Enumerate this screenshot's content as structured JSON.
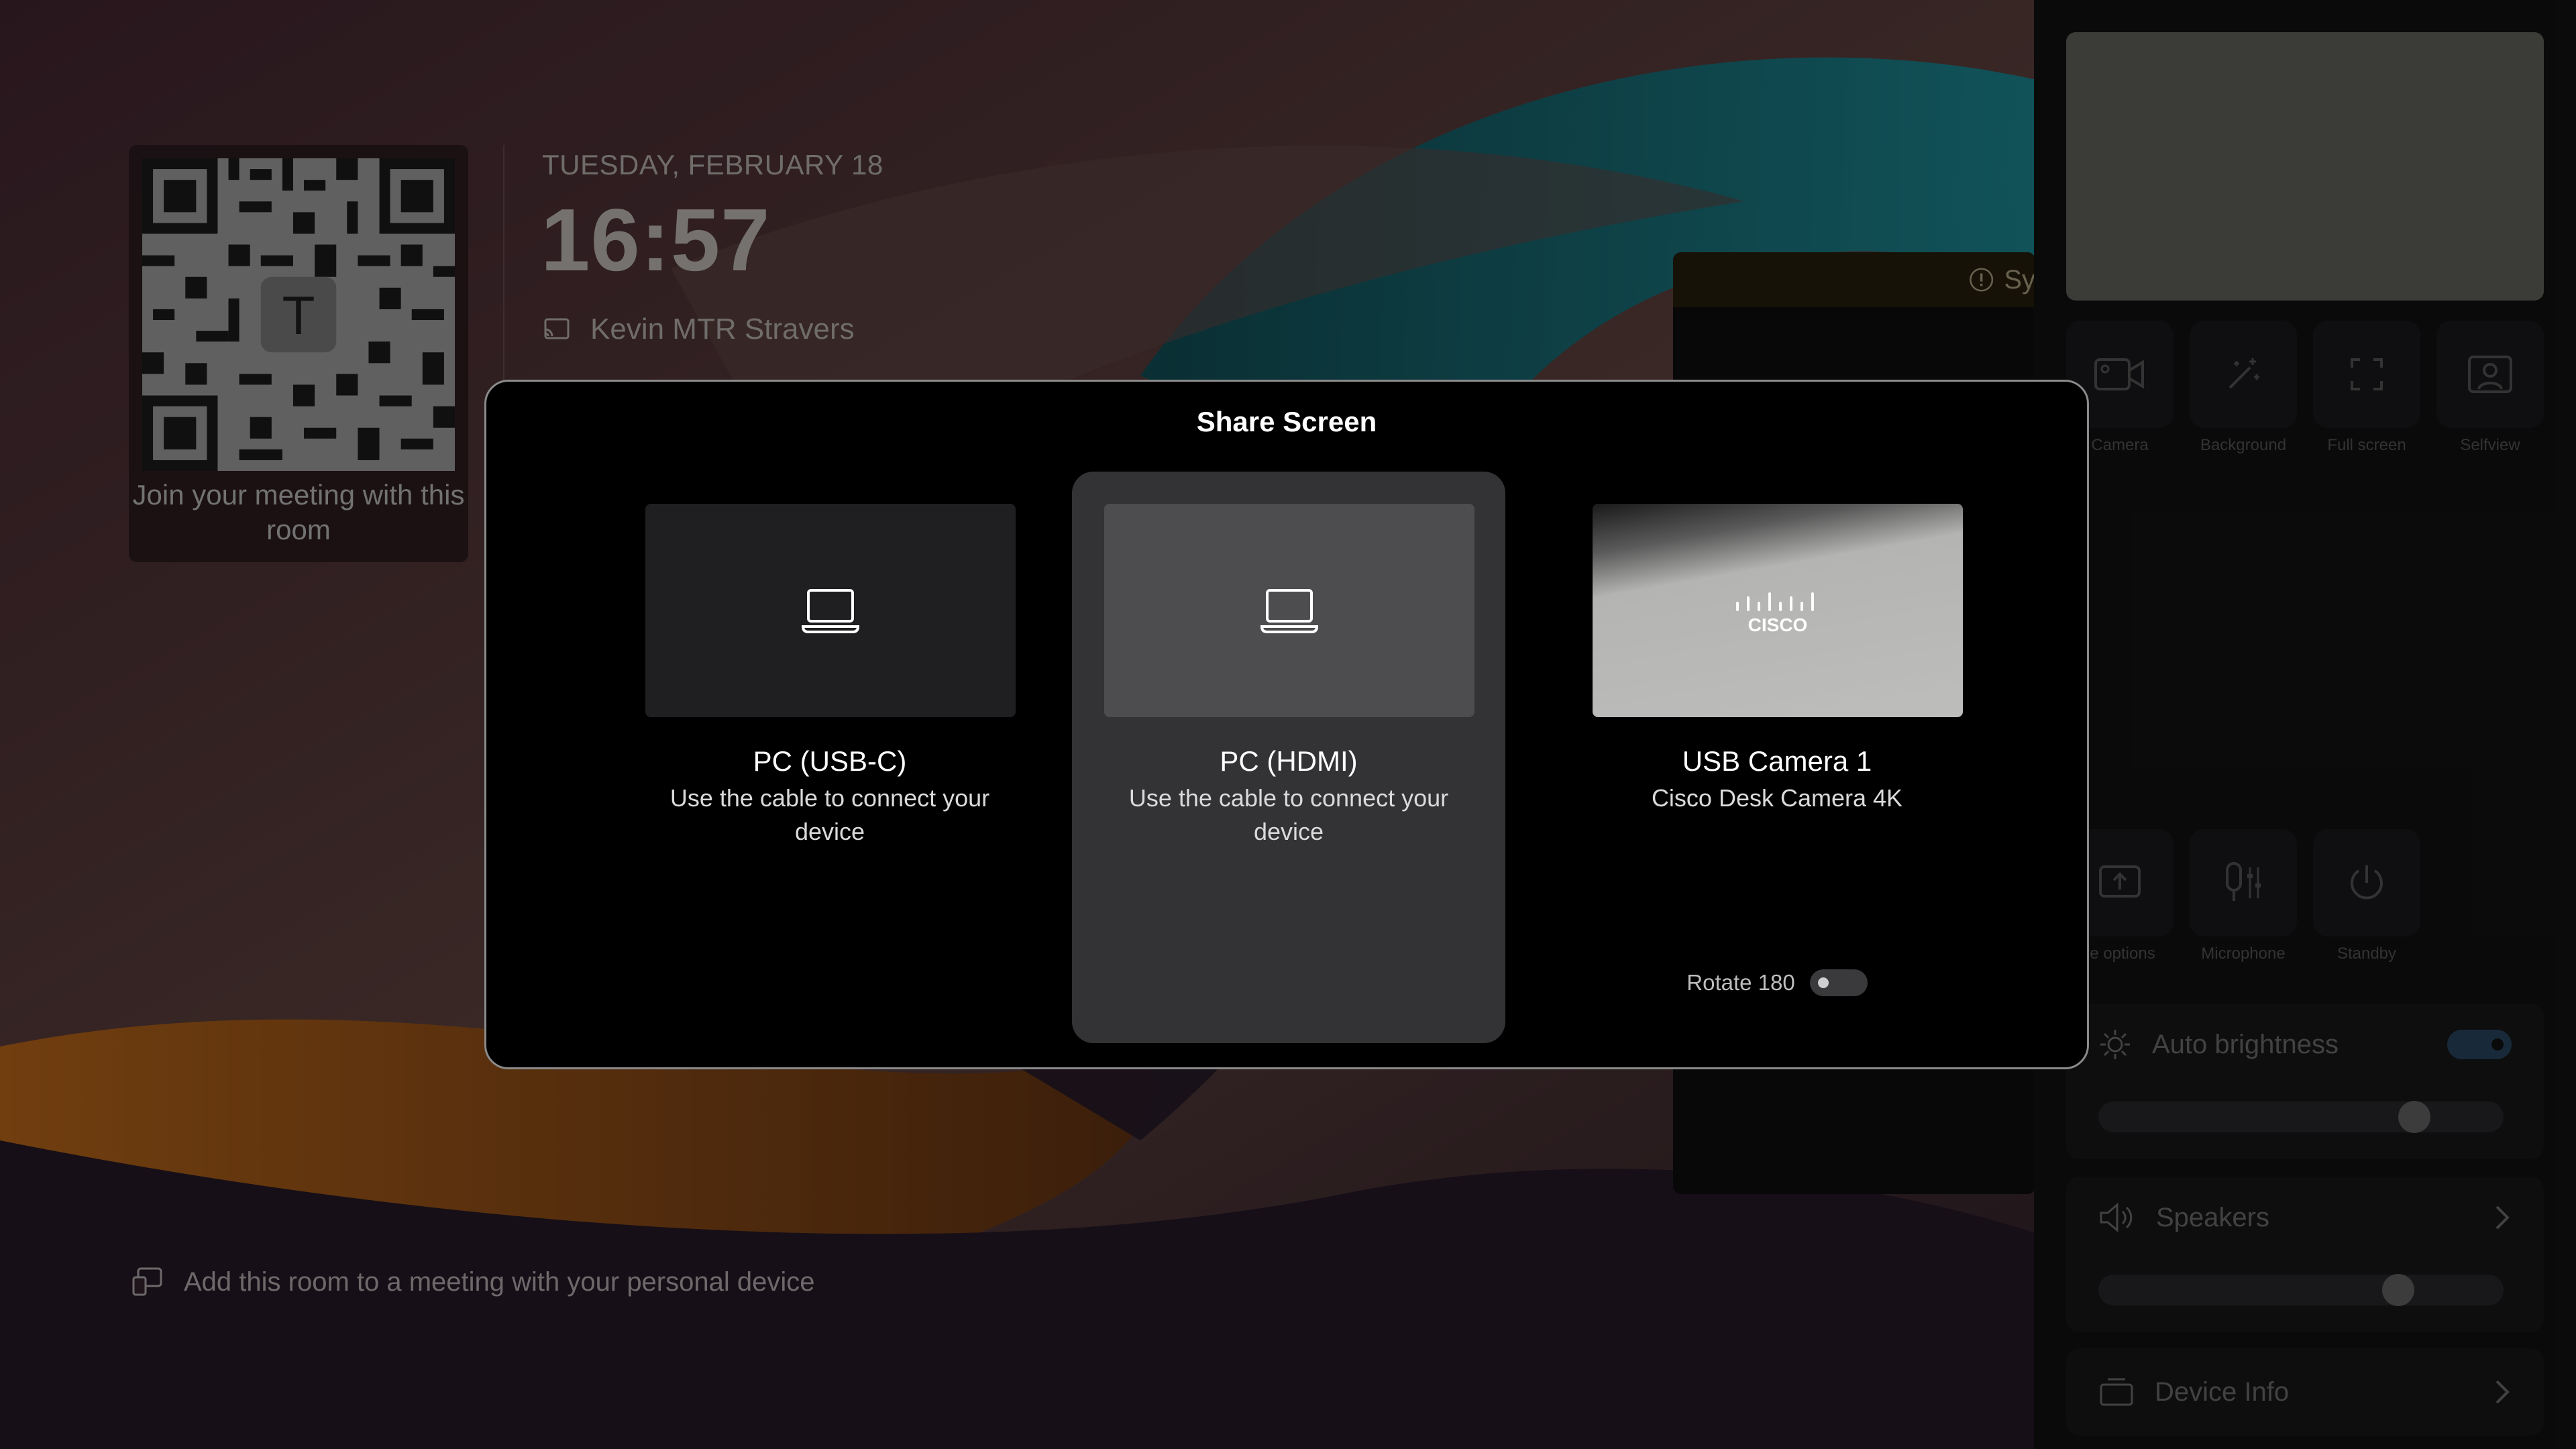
{
  "home": {
    "qr_caption": "Join your meeting with this room",
    "date": "TUESDAY, FEBRUARY 18",
    "time": "16:57",
    "room_name": "Kevin MTR Stravers",
    "add_room_text": "Add this room to a meeting with your personal device"
  },
  "background_panel": {
    "warning_text": "Sy"
  },
  "control_panel": {
    "quick_buttons": [
      {
        "label": "Camera",
        "icon": "camera-icon"
      },
      {
        "label": "Background",
        "icon": "magic-wand-icon"
      },
      {
        "label": "Full screen",
        "icon": "fullscreen-icon"
      },
      {
        "label": "Selfview",
        "icon": "selfview-icon"
      }
    ],
    "action_buttons": [
      {
        "label": "re options",
        "icon": "share-options-icon"
      },
      {
        "label": "Microphone",
        "icon": "microphone-icon"
      },
      {
        "label": "Standby",
        "icon": "power-icon"
      }
    ],
    "brightness": {
      "label": "Auto brightness",
      "auto_on": true,
      "level": 0.78
    },
    "speakers": {
      "label": "Speakers",
      "level": 0.74
    },
    "device_info": {
      "label": "Device Info"
    }
  },
  "share_modal": {
    "title": "Share Screen",
    "sources": [
      {
        "title": "PC (USB-C)",
        "subtitle": "Use the cable to connect your device",
        "icon": "laptop-icon",
        "selected": false
      },
      {
        "title": "PC (HDMI)",
        "subtitle": "Use the cable to connect your device",
        "icon": "laptop-icon",
        "selected": true
      },
      {
        "title": "USB Camera 1",
        "subtitle": "Cisco Desk Camera 4K",
        "icon": "camera-preview",
        "selected": false
      }
    ],
    "rotate_label": "Rotate 180",
    "rotate_on": false,
    "camera_logo_text": "CISCO"
  },
  "colors": {
    "accent_toggle": "#2d4e6c",
    "selected_source": "#333335",
    "modal_border": "#8a8a8a"
  }
}
